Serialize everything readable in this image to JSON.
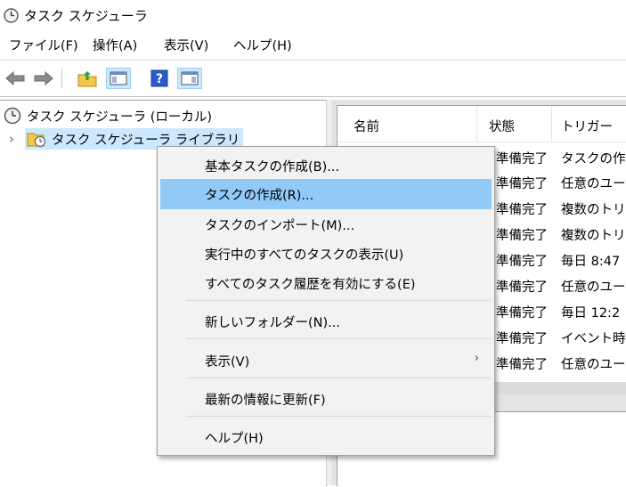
{
  "window": {
    "title": "タスク スケジューラ",
    "icon": "clock-icon"
  },
  "menubar": {
    "items": [
      {
        "label": "ファイル(F)"
      },
      {
        "label": "操作(A)"
      },
      {
        "label": "表示(V)"
      },
      {
        "label": "ヘルプ(H)"
      }
    ]
  },
  "toolbar": {
    "buttons": [
      {
        "icon": "back-arrow-icon"
      },
      {
        "icon": "forward-arrow-icon"
      },
      {
        "icon": "up-folder-icon"
      },
      {
        "icon": "show-hide-console-tree-icon"
      },
      {
        "icon": "help-icon"
      },
      {
        "icon": "show-hide-action-pane-icon"
      }
    ]
  },
  "tree": {
    "root": {
      "label": "タスク スケジューラ (ローカル)",
      "icon": "clock-icon"
    },
    "library": {
      "label": "タスク スケジューラ ライブラリ",
      "icon": "folder-clock-icon",
      "expander": "›"
    }
  },
  "task_list": {
    "columns": [
      "名前",
      "状態",
      "トリガー"
    ],
    "rows": [
      {
        "status": "準備完了",
        "trigger": "タスクの作"
      },
      {
        "status": "準備完了",
        "trigger": "任意のユー"
      },
      {
        "status": "準備完了",
        "trigger": "複数のトリ"
      },
      {
        "status": "準備完了",
        "trigger": "複数のトリ"
      },
      {
        "status": "準備完了",
        "trigger": "毎日 8:47"
      },
      {
        "status": "準備完了",
        "trigger": "任意のユー"
      },
      {
        "status": "準備完了",
        "trigger": "毎日 12:2"
      },
      {
        "status": "準備完了",
        "trigger": "イベント時"
      },
      {
        "status": "準備完了",
        "trigger": "任意のユー"
      }
    ]
  },
  "context_menu": {
    "items": [
      {
        "label": "基本タスクの作成(B)..."
      },
      {
        "label": "タスクの作成(R)...",
        "highlighted": true
      },
      {
        "label": "タスクのインポート(M)..."
      },
      {
        "label": "実行中のすべてのタスクの表示(U)"
      },
      {
        "label": "すべてのタスク履歴を有効にする(E)"
      },
      {
        "label": "新しいフォルダー(N)..."
      },
      {
        "label": "表示(V)",
        "submenu_arrow": "›"
      },
      {
        "label": "最新の情報に更新(F)"
      },
      {
        "label": "ヘルプ(H)"
      }
    ]
  },
  "colors": {
    "highlight": "#91c9f7",
    "selection": "#cce8ff",
    "menu_bg": "#f2f2f2"
  }
}
